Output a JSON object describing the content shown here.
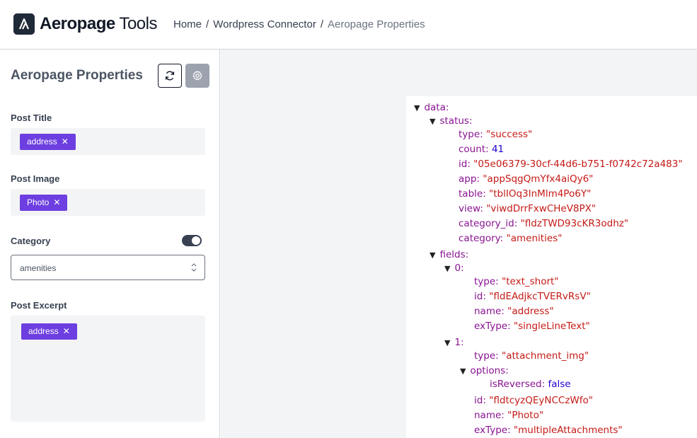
{
  "app": {
    "brand_bold": "Aeropage",
    "brand_light": "Tools"
  },
  "breadcrumb": {
    "home": "Home",
    "connector": "Wordpress Connector",
    "current": "Aeropage Properties",
    "separator": "/"
  },
  "sidebar": {
    "title": "Aeropage Properties",
    "post_title": {
      "label": "Post Title",
      "tag": "address"
    },
    "post_image": {
      "label": "Post Image",
      "tag": "Photo"
    },
    "category": {
      "label": "Category",
      "toggle_on": true,
      "selected": "amenities"
    },
    "post_excerpt": {
      "label": "Post Excerpt",
      "tag": "address"
    },
    "tag_remove_glyph": "✕"
  },
  "json_tree": {
    "data_key": "data:",
    "status_key": "status:",
    "status": [
      {
        "k": "type:",
        "v": "\"success\"",
        "t": "str"
      },
      {
        "k": "count:",
        "v": "41",
        "t": "num"
      },
      {
        "k": "id:",
        "v": "\"05e06379-30cf-44d6-b751-f0742c72a483\"",
        "t": "str"
      },
      {
        "k": "app:",
        "v": "\"appSqgQmYfx4aiQy6\"",
        "t": "str"
      },
      {
        "k": "table:",
        "v": "\"tblIOq3InMlm4Po6Y\"",
        "t": "str"
      },
      {
        "k": "view:",
        "v": "\"viwdDrrFxwCHeV8PX\"",
        "t": "str"
      },
      {
        "k": "category_id:",
        "v": "\"fldzTWD93cKR3odhz\"",
        "t": "str"
      },
      {
        "k": "category:",
        "v": "\"amenities\"",
        "t": "str"
      }
    ],
    "fields_key": "fields:",
    "field0_key": "0:",
    "field0": [
      {
        "k": "type:",
        "v": "\"text_short\"",
        "t": "str"
      },
      {
        "k": "id:",
        "v": "\"fldEAdjkcTVERvRsV\"",
        "t": "str"
      },
      {
        "k": "name:",
        "v": "\"address\"",
        "t": "str"
      },
      {
        "k": "exType:",
        "v": "\"singleLineText\"",
        "t": "str"
      }
    ],
    "field1_key": "1:",
    "field1_type": {
      "k": "type:",
      "v": "\"attachment_img\"",
      "t": "str"
    },
    "options_key": "options:",
    "options": {
      "k": "isReversed:",
      "v": "false",
      "t": "bool"
    },
    "field1": [
      {
        "k": "id:",
        "v": "\"fldtcyzQEyNCCzWfo\"",
        "t": "str"
      },
      {
        "k": "name:",
        "v": "\"Photo\"",
        "t": "str"
      },
      {
        "k": "exType:",
        "v": "\"multipleAttachments\"",
        "t": "str"
      }
    ]
  }
}
